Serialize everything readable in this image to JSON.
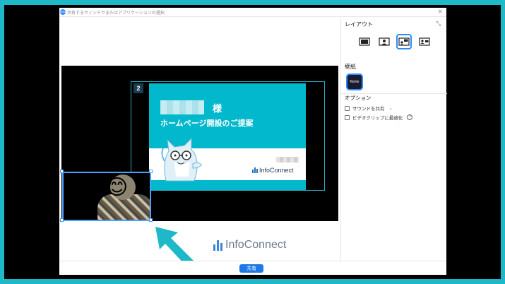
{
  "window": {
    "title": "共有するウィンドウまたはアプリケーションの選択",
    "app_icon_text": "zoom"
  },
  "slide": {
    "number": "2",
    "honorific": "様",
    "heading": "ホームページ開設のご提案",
    "logo_text": "InfoConnect"
  },
  "camera": {
    "face_emoji": "😊"
  },
  "brand": {
    "logo_text": "InfoConnect"
  },
  "side_panel": {
    "layout_label": "レイアウト",
    "wallpaper_label": "壁紙",
    "wallpaper_none": "None",
    "options_label": "オプション",
    "options": [
      {
        "label": "サウンドを共有",
        "checked": false
      },
      {
        "label": "ビデオクリップに最適化",
        "checked": false
      }
    ]
  },
  "footer": {
    "share_label": "共有"
  },
  "colors": {
    "background": "#1fb8c9",
    "accent": "#2d8cff",
    "slide": "#02b8cc"
  }
}
